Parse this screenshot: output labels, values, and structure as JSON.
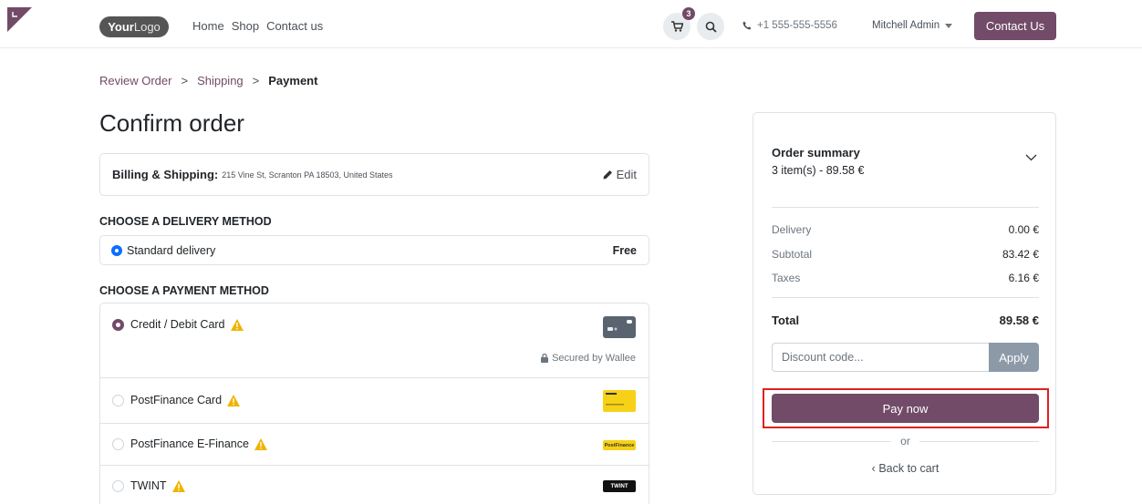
{
  "header": {
    "logo_bold": "Your",
    "logo_thin": "Logo",
    "nav": [
      "Home",
      "Shop",
      "Contact us"
    ],
    "cart_count": "3",
    "phone": "+1 555-555-5556",
    "user": "Mitchell Admin",
    "contact_button": "Contact Us"
  },
  "breadcrumb": {
    "step1": "Review Order",
    "step2": "Shipping",
    "step3": "Payment",
    "separator": ">"
  },
  "page_title": "Confirm order",
  "billing": {
    "label": "Billing & Shipping:",
    "address": "215 Vine St, Scranton PA 18503, United States",
    "edit": "Edit"
  },
  "delivery": {
    "section_title": "CHOOSE A DELIVERY METHOD",
    "method": "Standard delivery",
    "price": "Free"
  },
  "payment": {
    "section_title": "CHOOSE A PAYMENT METHOD",
    "methods": [
      {
        "label": "Credit / Debit Card",
        "selected": true
      },
      {
        "label": "PostFinance Card",
        "selected": false
      },
      {
        "label": "PostFinance E-Finance",
        "selected": false
      },
      {
        "label": "TWINT",
        "selected": false
      }
    ],
    "secured_by": "Secured by Wallee",
    "efinance_logo_text": "PostFinance",
    "twint_logo_text": "TWINT"
  },
  "summary": {
    "title": "Order summary",
    "items": "3 item(s) -  89.58 €",
    "delivery_label": "Delivery",
    "delivery_value": "0.00 €",
    "subtotal_label": "Subtotal",
    "subtotal_value": "83.42 €",
    "taxes_label": "Taxes",
    "taxes_value": "6.16 €",
    "total_label": "Total",
    "total_value": "89.58 €",
    "discount_placeholder": "Discount code...",
    "apply": "Apply",
    "pay_now": "Pay now",
    "or": "or",
    "back_to_cart": "Back to cart"
  },
  "colors": {
    "brand": "#714b67",
    "warning": "#f0b400",
    "highlight": "#e02020"
  }
}
